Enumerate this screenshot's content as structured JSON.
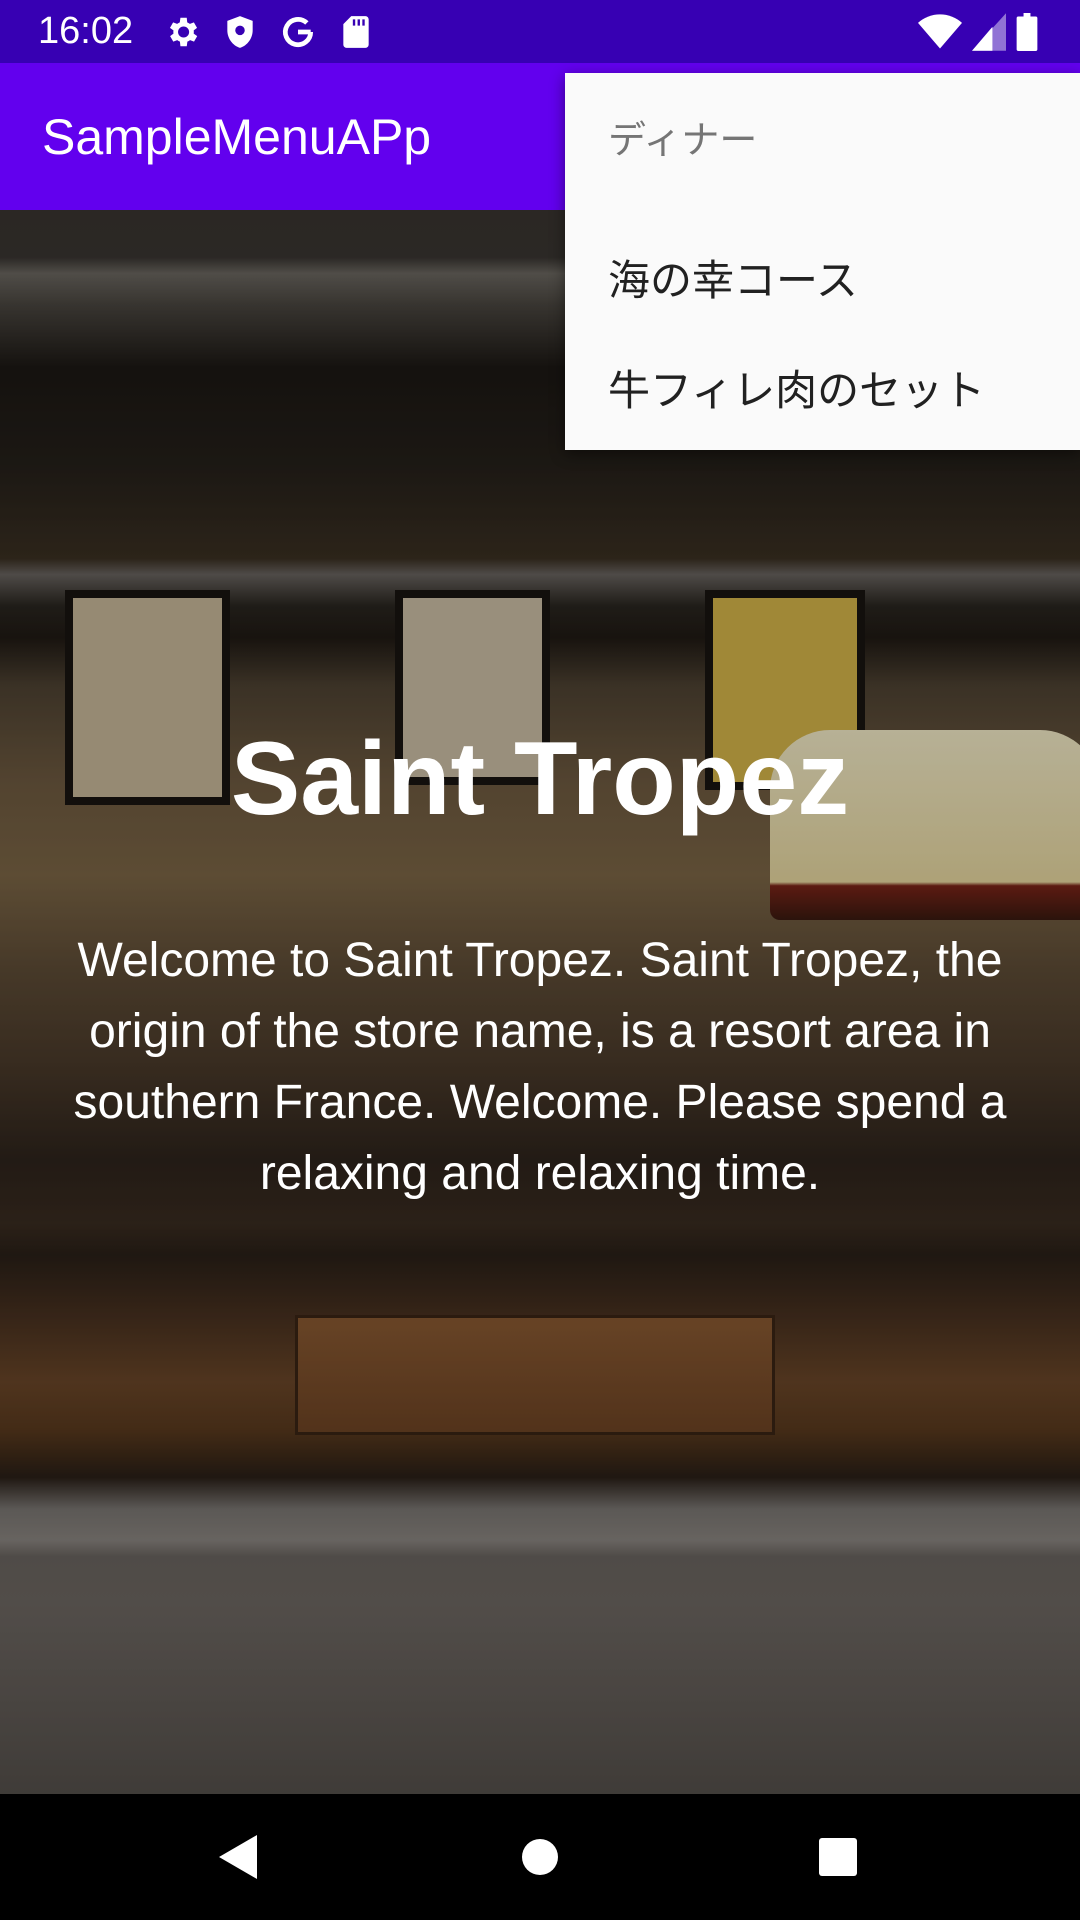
{
  "status_bar": {
    "time": "16:02",
    "left_icons": [
      "settings-icon",
      "shield-icon",
      "google-icon",
      "sd-card-icon"
    ],
    "right_icons": [
      "wifi-icon",
      "cell-signal-icon",
      "battery-icon"
    ]
  },
  "app_bar": {
    "title": "SampleMenuAPp",
    "color": "#6200EE"
  },
  "hero": {
    "title": "Saint Tropez",
    "description": "Welcome to Saint Tropez. Saint Tropez, the origin of the store name, is a resort area in southern France. Welcome. Please spend a relaxing and relaxing time."
  },
  "popup_menu": {
    "header": "ディナー",
    "items": [
      {
        "label": "海の幸コース"
      },
      {
        "label": "牛フィレ肉のセット"
      }
    ]
  },
  "nav_bar": {
    "buttons": [
      "back-icon",
      "home-icon",
      "recents-icon"
    ]
  },
  "colors": {
    "status_bar": "#3700B3",
    "app_bar": "#6200EE",
    "menu_bg": "#fafafa"
  }
}
